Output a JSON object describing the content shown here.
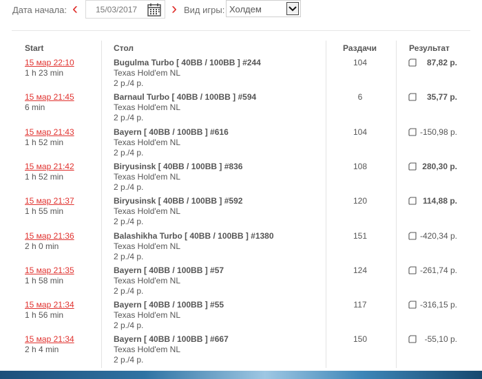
{
  "filters": {
    "date_label": "Дата начала:",
    "date_value": "15/03/2017",
    "game_label": "Вид игры:",
    "game_value": "Холдем"
  },
  "table": {
    "headers": {
      "start": "Start",
      "table": "Стол",
      "hands": "Раздачи",
      "result": "Результат"
    },
    "rows": [
      {
        "time": "15 мар 22:10",
        "duration": "1 h 23 min",
        "name": "Bugulma Turbo [ 40BB / 100BB ] #244",
        "game": "Texas Hold'em NL",
        "stakes": "2 р./4 р.",
        "hands": "104",
        "result": "87,82 р.",
        "bold": true
      },
      {
        "time": "15 мар 21:45",
        "duration": "6 min",
        "name": "Barnaul Turbo [ 40BB / 100BB ] #594",
        "game": "Texas Hold'em NL",
        "stakes": "2 р./4 р.",
        "hands": "6",
        "result": "35,77 р.",
        "bold": true
      },
      {
        "time": "15 мар 21:43",
        "duration": "1 h 52 min",
        "name": "Bayern [ 40BB / 100BB ] #616",
        "game": "Texas Hold'em NL",
        "stakes": "2 р./4 р.",
        "hands": "104",
        "result": "-150,98 р.",
        "bold": false
      },
      {
        "time": "15 мар 21:42",
        "duration": "1 h 52 min",
        "name": "Biryusinsk [ 40BB / 100BB ] #836",
        "game": "Texas Hold'em NL",
        "stakes": "2 р./4 р.",
        "hands": "108",
        "result": "280,30 р.",
        "bold": true
      },
      {
        "time": "15 мар 21:37",
        "duration": "1 h 55 min",
        "name": "Biryusinsk [ 40BB / 100BB ] #592",
        "game": "Texas Hold'em NL",
        "stakes": "2 р./4 р.",
        "hands": "120",
        "result": "114,88 р.",
        "bold": true
      },
      {
        "time": "15 мар 21:36",
        "duration": "2 h 0 min",
        "name": "Balashikha Turbo [ 40BB / 100BB ] #1380",
        "game": "Texas Hold'em NL",
        "stakes": "2 р./4 р.",
        "hands": "151",
        "result": "-420,34 р.",
        "bold": false
      },
      {
        "time": "15 мар 21:35",
        "duration": "1 h 58 min",
        "name": "Bayern [ 40BB / 100BB ] #57",
        "game": "Texas Hold'em NL",
        "stakes": "2 р./4 р.",
        "hands": "124",
        "result": "-261,74 р.",
        "bold": false
      },
      {
        "time": "15 мар 21:34",
        "duration": "1 h 56 min",
        "name": "Bayern [ 40BB / 100BB ] #55",
        "game": "Texas Hold'em NL",
        "stakes": "2 р./4 р.",
        "hands": "117",
        "result": "-316,15 р.",
        "bold": false
      },
      {
        "time": "15 мар 21:34",
        "duration": "2 h 4 min",
        "name": "Bayern [ 40BB / 100BB ] #667",
        "game": "Texas Hold'em NL",
        "stakes": "2 р./4 р.",
        "hands": "150",
        "result": "-55,10 р.",
        "bold": false
      }
    ]
  },
  "colors": {
    "accent": "#e0312e",
    "text": "#555555",
    "divider": "#e3e3e3"
  }
}
